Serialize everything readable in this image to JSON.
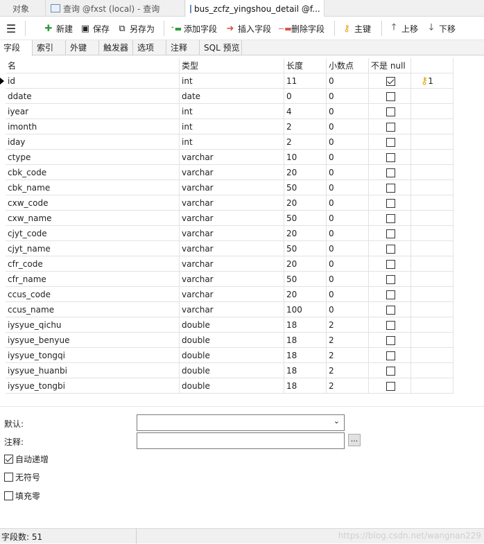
{
  "tabs": [
    {
      "label": "对象",
      "icon": "none"
    },
    {
      "label": "查询 @fxst (local) - 查询",
      "icon": "query-icon"
    },
    {
      "label": "bus_zcfz_yingshou_detail @f...",
      "icon": "table-icon"
    }
  ],
  "toolbar": {
    "menu_icon": "hamburger-icon",
    "new_label": "新建",
    "save_label": "保存",
    "save_as_label": "另存为",
    "add_field_label": "添加字段",
    "insert_field_label": "插入字段",
    "delete_field_label": "删除字段",
    "primary_key_label": "主键",
    "move_up_label": "上移",
    "move_down_label": "下移"
  },
  "subtabs": [
    "字段",
    "索引",
    "外键",
    "触发器",
    "选项",
    "注释",
    "SQL 预览"
  ],
  "grid": {
    "headers": [
      "名",
      "类型",
      "长度",
      "小数点",
      "不是 null",
      ""
    ],
    "rows": [
      {
        "name": "id",
        "type": "int",
        "len": "11",
        "dec": "0",
        "notnull": true,
        "key": "1"
      },
      {
        "name": "ddate",
        "type": "date",
        "len": "0",
        "dec": "0",
        "notnull": false,
        "key": ""
      },
      {
        "name": "iyear",
        "type": "int",
        "len": "4",
        "dec": "0",
        "notnull": false,
        "key": ""
      },
      {
        "name": "imonth",
        "type": "int",
        "len": "2",
        "dec": "0",
        "notnull": false,
        "key": ""
      },
      {
        "name": "iday",
        "type": "int",
        "len": "2",
        "dec": "0",
        "notnull": false,
        "key": ""
      },
      {
        "name": "ctype",
        "type": "varchar",
        "len": "10",
        "dec": "0",
        "notnull": false,
        "key": ""
      },
      {
        "name": "cbk_code",
        "type": "varchar",
        "len": "20",
        "dec": "0",
        "notnull": false,
        "key": ""
      },
      {
        "name": "cbk_name",
        "type": "varchar",
        "len": "50",
        "dec": "0",
        "notnull": false,
        "key": ""
      },
      {
        "name": "cxw_code",
        "type": "varchar",
        "len": "20",
        "dec": "0",
        "notnull": false,
        "key": ""
      },
      {
        "name": "cxw_name",
        "type": "varchar",
        "len": "50",
        "dec": "0",
        "notnull": false,
        "key": ""
      },
      {
        "name": "cjyt_code",
        "type": "varchar",
        "len": "20",
        "dec": "0",
        "notnull": false,
        "key": ""
      },
      {
        "name": "cjyt_name",
        "type": "varchar",
        "len": "50",
        "dec": "0",
        "notnull": false,
        "key": ""
      },
      {
        "name": "cfr_code",
        "type": "varchar",
        "len": "20",
        "dec": "0",
        "notnull": false,
        "key": ""
      },
      {
        "name": "cfr_name",
        "type": "varchar",
        "len": "50",
        "dec": "0",
        "notnull": false,
        "key": ""
      },
      {
        "name": "ccus_code",
        "type": "varchar",
        "len": "20",
        "dec": "0",
        "notnull": false,
        "key": ""
      },
      {
        "name": "ccus_name",
        "type": "varchar",
        "len": "100",
        "dec": "0",
        "notnull": false,
        "key": ""
      },
      {
        "name": "iysyue_qichu",
        "type": "double",
        "len": "18",
        "dec": "2",
        "notnull": false,
        "key": ""
      },
      {
        "name": "iysyue_benyue",
        "type": "double",
        "len": "18",
        "dec": "2",
        "notnull": false,
        "key": ""
      },
      {
        "name": "iysyue_tongqi",
        "type": "double",
        "len": "18",
        "dec": "2",
        "notnull": false,
        "key": ""
      },
      {
        "name": "iysyue_huanbi",
        "type": "double",
        "len": "18",
        "dec": "2",
        "notnull": false,
        "key": ""
      },
      {
        "name": "iysyue_tongbi",
        "type": "double",
        "len": "18",
        "dec": "2",
        "notnull": false,
        "key": ""
      }
    ]
  },
  "props": {
    "default_label": "默认:",
    "comment_label": "注释:",
    "comment_button": "...",
    "auto_increment_label": "自动递增",
    "auto_increment_checked": true,
    "unsigned_label": "无符号",
    "unsigned_checked": false,
    "zerofill_label": "填充零",
    "zerofill_checked": false
  },
  "status": {
    "field_count": "字段数: 51",
    "watermark": "https://blog.csdn.net/wangnan229"
  },
  "colors": {
    "key_icon": "#e0a000",
    "accent": "#2a7de1"
  }
}
